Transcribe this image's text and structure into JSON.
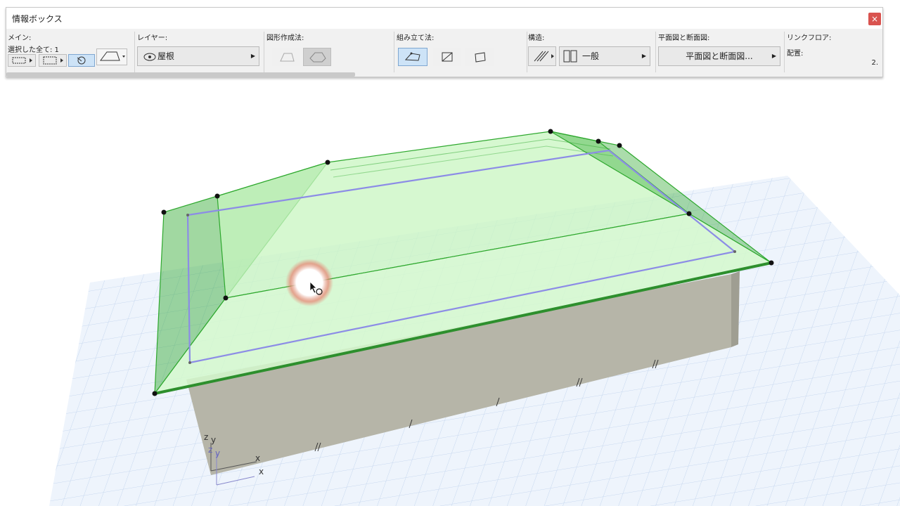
{
  "infobox": {
    "title": "情報ボックス",
    "close": "×",
    "main": {
      "label": "メイン:",
      "selection": "選択した全て: 1"
    },
    "layer": {
      "label": "レイヤー:",
      "value": "屋根"
    },
    "geometry": {
      "label": "図形作成法:"
    },
    "construction": {
      "label": "組み立て法:"
    },
    "structure": {
      "label": "構造:",
      "value": "一般"
    },
    "plan_section": {
      "label": "平面図と断面図:",
      "value": "平面図と断面図..."
    },
    "link_floor": {
      "label": "リンクフロア:",
      "placement": "配置:",
      "value": "2."
    }
  },
  "axes": {
    "z1": "z",
    "y1": "y",
    "z2": "z",
    "y2": "y",
    "x1": "x",
    "x2": "x"
  },
  "colors": {
    "roof_fill": "#c8f5c0",
    "roof_edge": "#2ea82e",
    "selection_outline": "#8c8ce6",
    "wall": "#b6b5a8",
    "grid": "#c5d6ee",
    "grid_bg": "#eef4fc"
  }
}
